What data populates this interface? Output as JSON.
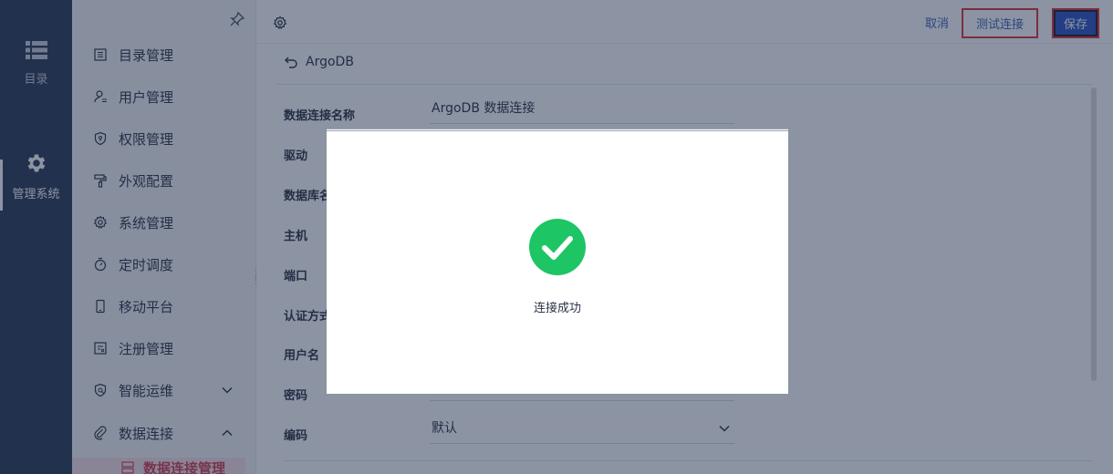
{
  "rail": {
    "items": [
      {
        "label": "目录",
        "icon": "list-icon"
      },
      {
        "label": "管理系统",
        "icon": "gear-icon",
        "active": true
      }
    ]
  },
  "sidebar": {
    "items": [
      {
        "label": "目录管理",
        "icon": "catalog-icon"
      },
      {
        "label": "用户管理",
        "icon": "user-icon"
      },
      {
        "label": "权限管理",
        "icon": "shield-icon"
      },
      {
        "label": "外观配置",
        "icon": "paint-roller-icon"
      },
      {
        "label": "系统管理",
        "icon": "gear-icon"
      },
      {
        "label": "定时调度",
        "icon": "timer-icon"
      },
      {
        "label": "移动平台",
        "icon": "mobile-icon"
      },
      {
        "label": "注册管理",
        "icon": "register-icon"
      },
      {
        "label": "智能运维",
        "icon": "ops-icon",
        "expand": "down"
      },
      {
        "label": "数据连接",
        "icon": "paperclip-icon",
        "expand": "up"
      }
    ],
    "subitem": {
      "label": "数据连接管理",
      "icon": "database-icon"
    }
  },
  "topbar": {
    "cancel_label": "取消",
    "test_label": "测试连接",
    "save_label": "保存"
  },
  "page": {
    "back_title": "ArgoDB"
  },
  "form": {
    "fields": [
      {
        "label": "数据连接名称",
        "value": "ArgoDB 数据连接"
      },
      {
        "label": "驱动",
        "value": ""
      },
      {
        "label": "数据库名称",
        "value": ""
      },
      {
        "label": "主机",
        "value": ""
      },
      {
        "label": "端口",
        "value": ""
      },
      {
        "label": "认证方式",
        "value": ""
      },
      {
        "label": "用户名",
        "value": ""
      },
      {
        "label": "密码",
        "value": ""
      },
      {
        "label": "编码",
        "value": "默认"
      }
    ]
  },
  "modal": {
    "message": "连接成功",
    "icon": "check-circle-icon"
  },
  "colors": {
    "rail_bg": "#2b3a55",
    "accent_blue": "#2d54c4",
    "highlight_red": "#e2323c",
    "success_green": "#1ec564",
    "active_sub_bg": "#fbe3e6",
    "active_sub_text": "#d53f55"
  }
}
